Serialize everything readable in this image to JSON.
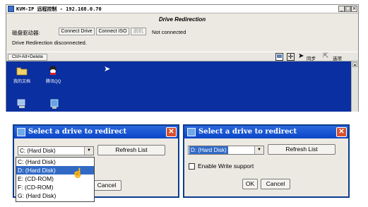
{
  "kvm_window": {
    "title": "KVM-IP 远程控制 - 192.168.0.70",
    "controls": {
      "minimize": "_",
      "maximize": "□",
      "close": "×"
    },
    "heading": "Drive Redirection",
    "disk_drive_label": "磁盘驱动器:",
    "buttons": {
      "connect_drive": "Connect Drive",
      "connect_iso": "Connect ISO",
      "disconnect": "脱机"
    },
    "connection_status": "Not connected",
    "redirection_status": "Drive Redirection disconnected."
  },
  "toolbar": {
    "ctrl_alt_delete": "Ctrl+Alt+Delete",
    "sync_label": "同步",
    "options_label": "选项"
  },
  "desktop": {
    "icons": [
      {
        "label": "我的文档",
        "icon": "my-documents-icon"
      },
      {
        "label": "腾讯QQ",
        "icon": "qq-icon"
      },
      {
        "label": "",
        "icon": "computer-icon"
      },
      {
        "label": "",
        "icon": "network-icon"
      }
    ]
  },
  "dialog_left": {
    "title": "Select a drive to redirect",
    "selected": "C: (Hard Disk)",
    "refresh_label": "Refresh List",
    "cancel_label": "Cancel",
    "options": [
      "C: (Hard Disk)",
      "D: (Hard Disk)",
      "E: (CD-ROM)",
      "F: (CD-ROM)",
      "G: (Hard Disk)"
    ],
    "highlighted_option": "D: (Hard Disk)"
  },
  "dialog_right": {
    "title": "Select a drive to redirect",
    "selected": "D: (Hard Disk)",
    "refresh_label": "Refresh List",
    "write_support_label": "Enable Write support",
    "write_support_checked": false,
    "ok_label": "OK",
    "cancel_label": "Cancel"
  },
  "colors": {
    "desktop_blue": "#0a2fa0",
    "title_blue": "#0a45c8",
    "selection_blue": "#316ac5",
    "close_red": "#d8502d"
  }
}
